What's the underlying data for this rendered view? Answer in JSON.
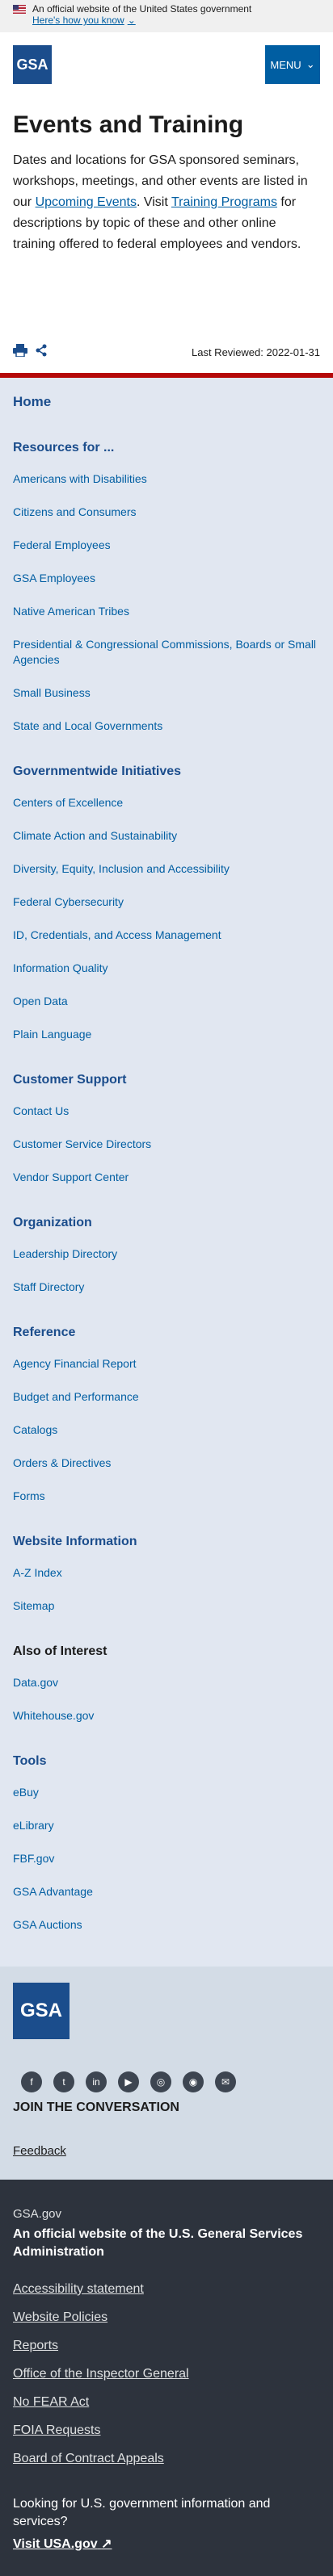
{
  "banner": {
    "text": "An official website of the United States government",
    "link": "Here's how you know"
  },
  "header": {
    "logo_text": "GSA",
    "menu_label": "MENU"
  },
  "page": {
    "title": "Events and Training",
    "intro_before": "Dates and locations for GSA sponsored seminars, workshops, meetings, and other events are listed in our ",
    "link1": "Upcoming Events",
    "intro_mid": ". Visit ",
    "link2": "Training Programs",
    "intro_after": " for descriptions by topic of these and other online training offered to federal employees and vendors.",
    "last_reviewed": "Last Reviewed: 2022-01-31"
  },
  "sidenav": {
    "home": "Home",
    "sections": [
      {
        "title": "Resources for ...",
        "items": [
          "Americans with Disabilities",
          "Citizens and Consumers",
          "Federal Employees",
          "GSA Employees",
          "Native American Tribes",
          "Presidential & Congressional Commissions, Boards or Small Agencies",
          "Small Business",
          "State and Local Governments"
        ]
      },
      {
        "title": "Governmentwide Initiatives",
        "items": [
          "Centers of Excellence",
          "Climate Action and Sustainability",
          "Diversity, Equity, Inclusion and Accessibility",
          "Federal Cybersecurity",
          "ID, Credentials, and Access Management",
          "Information Quality",
          "Open Data",
          "Plain Language"
        ]
      },
      {
        "title": "Customer Support",
        "items": [
          "Contact Us",
          "Customer Service Directors",
          "Vendor Support Center"
        ]
      },
      {
        "title": "Organization",
        "items": [
          "Leadership Directory",
          "Staff Directory"
        ]
      },
      {
        "title": "Reference",
        "items": [
          "Agency Financial Report",
          "Budget and Performance",
          "Catalogs",
          "Orders & Directives",
          "Forms"
        ]
      },
      {
        "title": "Website Information",
        "items": [
          "A-Z Index",
          "Sitemap"
        ]
      },
      {
        "title": "Also of Interest",
        "items": [
          "Data.gov",
          "Whitehouse.gov"
        ]
      },
      {
        "title": "Tools",
        "items": [
          "eBuy",
          "eLibrary",
          "FBF.gov",
          "GSA Advantage",
          "GSA Auctions"
        ]
      }
    ]
  },
  "footer": {
    "logo_text": "GSA",
    "social": [
      "facebook-icon",
      "twitter-icon",
      "linkedin-icon",
      "youtube-icon",
      "instagram-icon",
      "rss-icon",
      "email-icon"
    ],
    "join": "JOIN THE CONVERSATION",
    "feedback": "Feedback",
    "site": "GSA.gov",
    "official": "An official website of the U.S. General Services Administration",
    "links": [
      "Accessibility statement",
      "Website Policies",
      "Reports",
      "Office of the Inspector General",
      "No FEAR Act",
      "FOIA Requests",
      "Board of Contract Appeals"
    ],
    "looking": "Looking for U.S. government information and services?",
    "visit": "Visit USA.gov"
  }
}
